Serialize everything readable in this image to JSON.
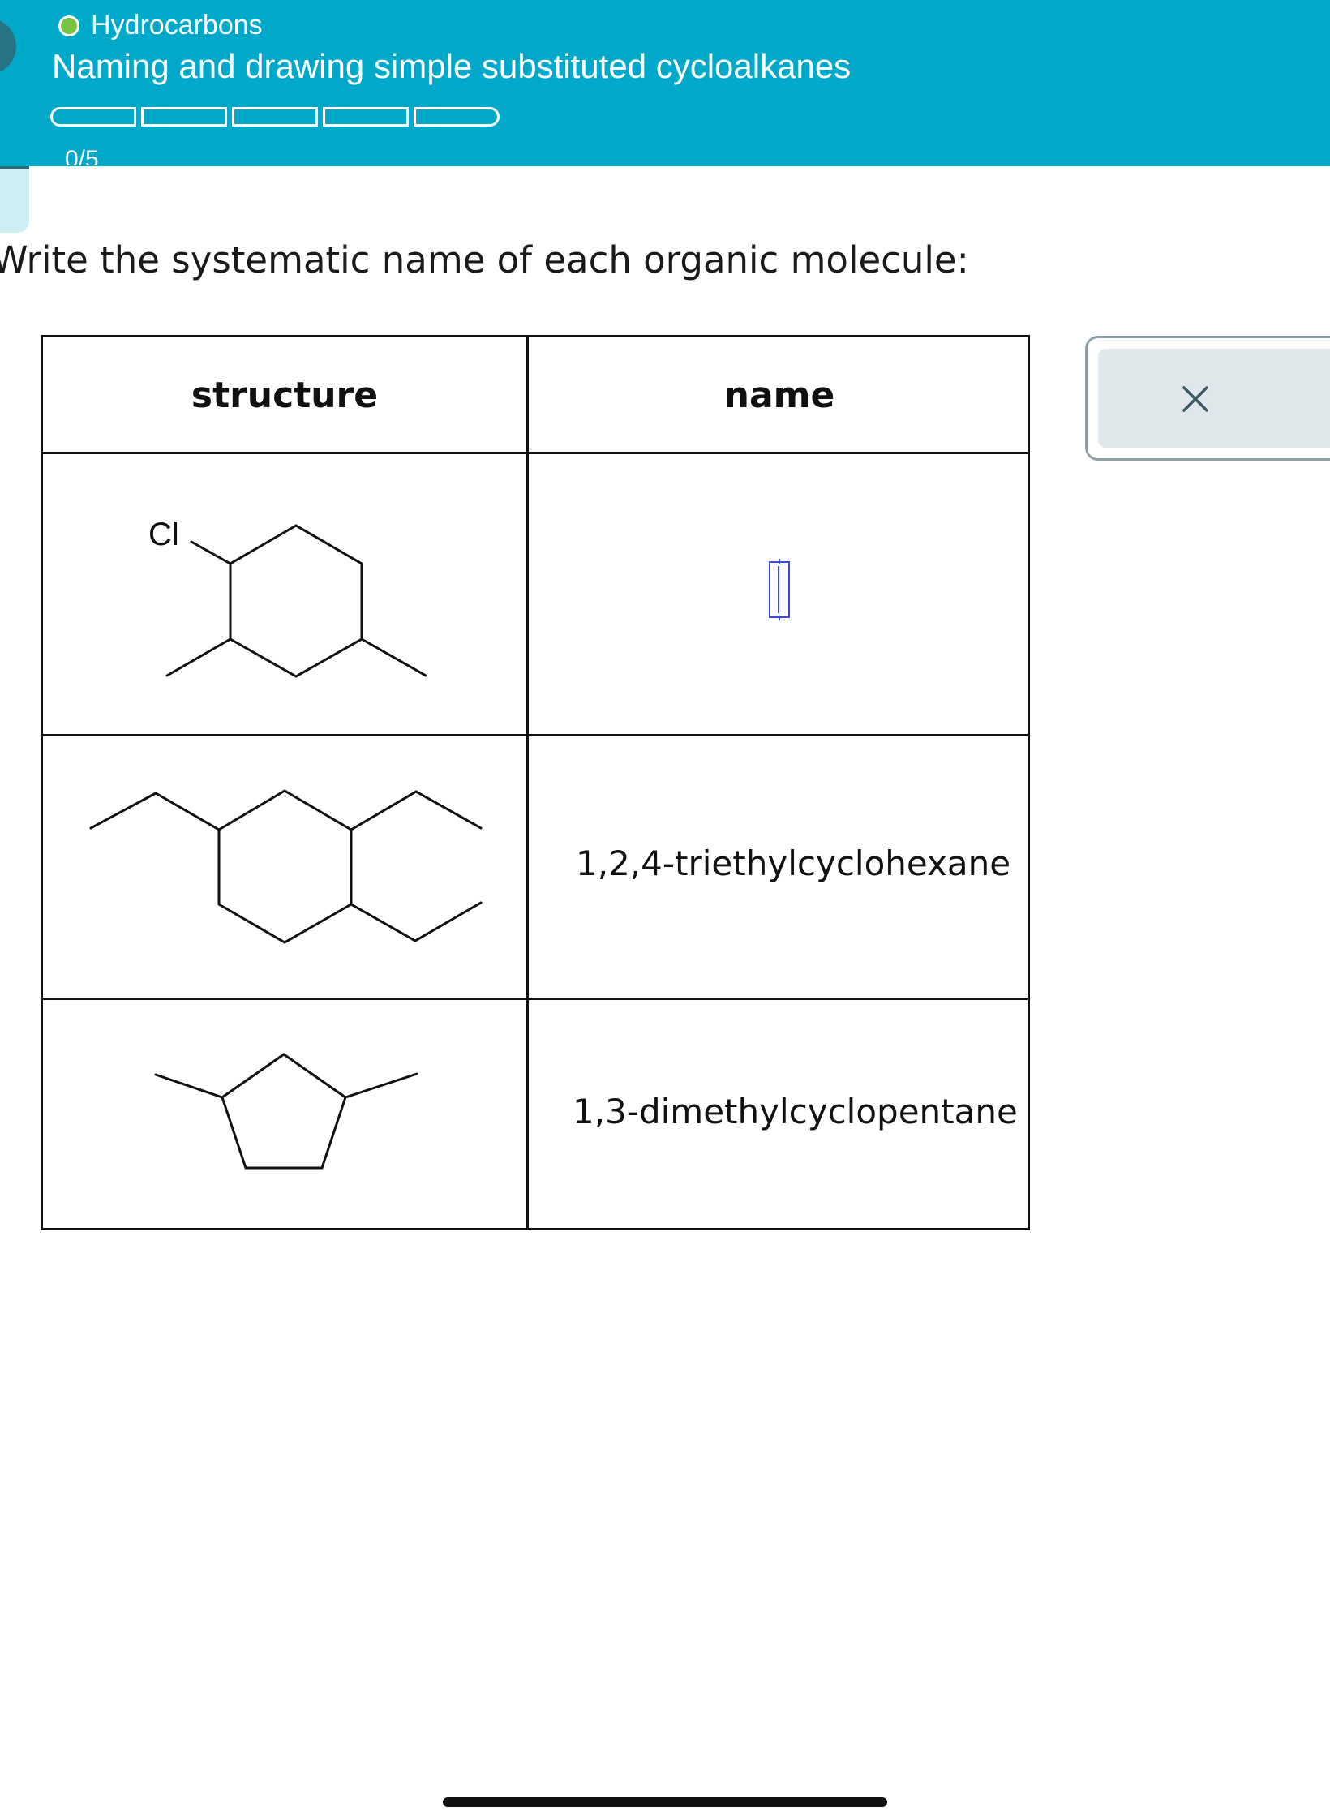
{
  "header": {
    "topic": "Hydrocarbons",
    "title": "Naming and drawing simple substituted cycloalkanes",
    "progress_count": "0/5",
    "progress_segments": 5,
    "progress_completed": 0,
    "accent_color": "#00a9c9",
    "topic_dot_color": "#7ac142"
  },
  "prompt": "Write the systematic name of each organic molecule:",
  "table": {
    "headers": {
      "structure": "structure",
      "name": "name"
    },
    "rows": [
      {
        "structure_label": "Cl",
        "name": "",
        "name_state": "active-input"
      },
      {
        "structure_label": "",
        "name": "1,2,4-triethylcyclohexane"
      },
      {
        "structure_label": "",
        "name": "1,3-dimethylcyclopentane"
      }
    ]
  },
  "close_button": {
    "icon": "close-icon"
  }
}
